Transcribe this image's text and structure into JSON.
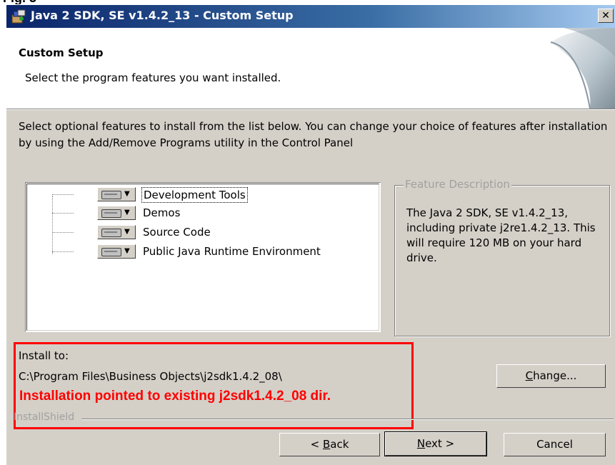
{
  "window": {
    "title": "Java 2 SDK, SE v1.4.2_13 - Custom Setup",
    "close_glyph": "✕"
  },
  "header": {
    "title": "Custom Setup",
    "subtitle": "Select the program features you want installed."
  },
  "intro": "Select optional features to install from the list below.  You can change your choice of features after installation by using the Add/Remove Programs utility in the Control Panel",
  "features": [
    {
      "label": "Development Tools",
      "selected": true,
      "icon": "hard-drive-icon"
    },
    {
      "label": "Demos",
      "selected": false,
      "icon": "hard-drive-icon"
    },
    {
      "label": "Source Code",
      "selected": false,
      "icon": "hard-drive-icon"
    },
    {
      "label": "Public Java Runtime Environment",
      "selected": false,
      "icon": "hard-drive-icon"
    }
  ],
  "feature_description": {
    "legend": "Feature Description",
    "text": "The Java 2 SDK, SE v1.4.2_13, including private j2re1.4.2_13. This will require 120 MB on your hard drive."
  },
  "install": {
    "label": "Install to:",
    "path": "C:\\Program Files\\Business Objects\\j2sdk1.4.2_08\\",
    "annotation": "Installation pointed to existing j2sdk1.4.2_08 dir."
  },
  "installshield_label": "InstallShield",
  "buttons": {
    "change": {
      "mnemonic": "C",
      "rest": "hange..."
    },
    "back": {
      "prefix": "< ",
      "mnemonic": "B",
      "rest": "ack"
    },
    "next": {
      "mnemonic": "N",
      "rest": "ext >"
    },
    "cancel": "Cancel"
  },
  "colors": {
    "annotation_red": "#ff0000",
    "title_bar": "#0a246a",
    "dialog_face": "#d4d0c8"
  }
}
